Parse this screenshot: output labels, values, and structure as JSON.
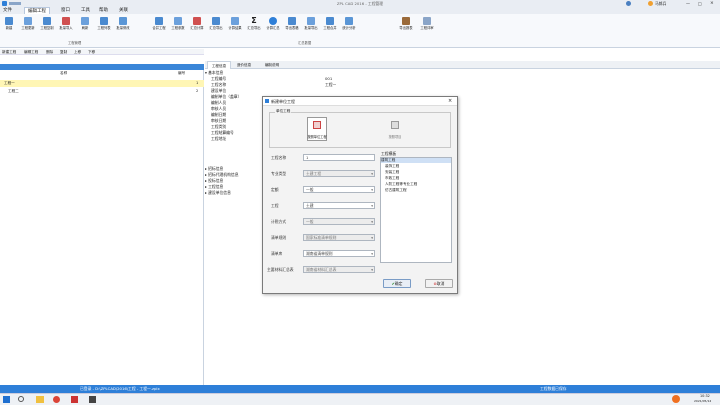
{
  "window": {
    "title": "ZPL CAD 2016 - 工程管理"
  },
  "menubar": {
    "items": [
      "文件",
      "编辑工程",
      "窗口",
      "工具",
      "帮助",
      "关联"
    ]
  },
  "ribbon": {
    "buttons": [
      "新建",
      "工程更新",
      "工程复制",
      "批量导入",
      "刷新",
      "工程列表",
      "批量修改",
      "合并工程",
      "工程参数",
      "汇总计算",
      "汇总导出",
      "计算结果",
      "汇总导出",
      "计算汇总",
      "导出表格",
      "批量导出",
      "工程合并",
      "统计分析",
      "导出报表",
      "工程评审"
    ],
    "groups": [
      "工程管理",
      "汇总数据"
    ]
  },
  "right_top": {
    "user": "马郎兵",
    "min": "—",
    "max": "□",
    "close": "×"
  },
  "left": {
    "toolbar": [
      "新建工程",
      "编辑工程",
      "删除",
      "复制",
      "上移",
      "下移"
    ],
    "header": {
      "name": "名称",
      "num": "编号"
    },
    "rows": [
      {
        "name": "工程一",
        "num": "1"
      },
      {
        "name": "工程二",
        "num": "2"
      }
    ]
  },
  "main": {
    "tabs": [
      "工程信息",
      "造价信息",
      "编制说明"
    ],
    "tree": [
      {
        "label": "▾ 基本信息",
        "value": ""
      },
      {
        "label": "工程编号",
        "value": "001"
      },
      {
        "label": "工程名称",
        "value": "工程一"
      },
      {
        "label": "建设单位",
        "value": ""
      },
      {
        "label": "编制单位（盖章）",
        "value": ""
      },
      {
        "label": "编制人员",
        "value": ""
      },
      {
        "label": "审核人员",
        "value": ""
      },
      {
        "label": "编制日期",
        "value": ""
      },
      {
        "label": "审核日期",
        "value": ""
      },
      {
        "label": "工程类别",
        "value": ""
      },
      {
        "label": "工程结算编号",
        "value": ""
      },
      {
        "label": "工程地址",
        "value": ""
      },
      {
        "label": "▸ 招标信息",
        "value": ""
      },
      {
        "label": "▸ 招标代理机构信息",
        "value": ""
      },
      {
        "label": "▸ 投标信息",
        "value": ""
      },
      {
        "label": "▸ 工程信息",
        "value": ""
      },
      {
        "label": "▸ 建设单位信息",
        "value": ""
      }
    ]
  },
  "dialog": {
    "title": "新建单位工程",
    "section": "单位工程",
    "opt1": "按照单位工程",
    "opt2": "按照项目",
    "fields": [
      {
        "label": "工程名称",
        "value": "1",
        "disabled": false
      },
      {
        "label": "专业类型",
        "value": "土建工程",
        "disabled": true
      },
      {
        "label": "定额",
        "value": "一般",
        "disabled": false
      },
      {
        "label": "工程",
        "value": "土建",
        "disabled": false
      },
      {
        "label": "计税方式",
        "value": "一般",
        "disabled": true
      },
      {
        "label": "清单规则",
        "value": "国家标准清单规则",
        "disabled": true
      },
      {
        "label": "清单库",
        "value": "湖南省清单规则",
        "disabled": false
      },
      {
        "label": "主要材料汇总表",
        "value": "湖南省材料汇总表",
        "disabled": true
      }
    ],
    "list_title": "工程模板",
    "list_items": [
      "建筑工程",
      "装饰工程",
      "安装工程",
      "市政工程",
      "人防工程等专业工程",
      "仿古建筑工程"
    ],
    "ok": "确定",
    "cancel": "取消"
  },
  "status": {
    "left": "已登录 - D:\\ZPLCAD\\2016\\工程 - 工程一.zplx",
    "right": "工程数据已保存"
  },
  "taskbar": {
    "time": "10:32",
    "date": "2021/05/14"
  }
}
